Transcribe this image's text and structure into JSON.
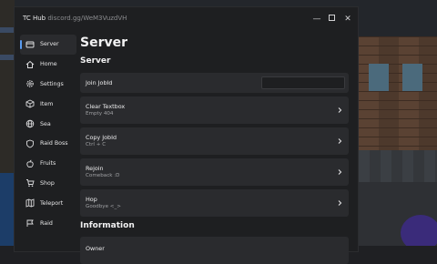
{
  "window": {
    "title": "TC Hub",
    "subtitle": "discord.gg/WeM3VuzdVH",
    "minimize_glyph": "—",
    "maximize_glyph": "☐",
    "close_glyph": "✕"
  },
  "sidebar": {
    "items": [
      {
        "label": "Server",
        "icon": "server-icon",
        "active": true
      },
      {
        "label": "Home",
        "icon": "home-icon"
      },
      {
        "label": "Settings",
        "icon": "gear-icon"
      },
      {
        "label": "Item",
        "icon": "box-icon"
      },
      {
        "label": "Sea",
        "icon": "globe-icon"
      },
      {
        "label": "Raid Boss",
        "icon": "shield-icon"
      },
      {
        "label": "Fruits",
        "icon": "fruit-icon"
      },
      {
        "label": "Shop",
        "icon": "cart-icon"
      },
      {
        "label": "Teleport",
        "icon": "map-icon"
      },
      {
        "label": "Raid",
        "icon": "flag-icon"
      }
    ]
  },
  "main": {
    "page_title": "Server",
    "sections": [
      {
        "title": "Server",
        "cards": [
          {
            "name": "Join JobId",
            "desc": "",
            "type": "input",
            "value": ""
          },
          {
            "name": "Clear Textbox",
            "desc": "Empty 404",
            "type": "button"
          },
          {
            "name": "Copy JobId",
            "desc": "Ctrl + C",
            "type": "button"
          },
          {
            "name": "Rejoin",
            "desc": "Comeback :D",
            "type": "button"
          },
          {
            "name": "Hop",
            "desc": "Goodbye <_>",
            "type": "button"
          }
        ]
      },
      {
        "title": "Information",
        "cards": [
          {
            "name": "Owner",
            "desc": "",
            "type": "label"
          }
        ]
      }
    ]
  },
  "colors": {
    "accent": "#5a9cf0",
    "card": "#2a2b2e",
    "window": "#1e1f21"
  }
}
